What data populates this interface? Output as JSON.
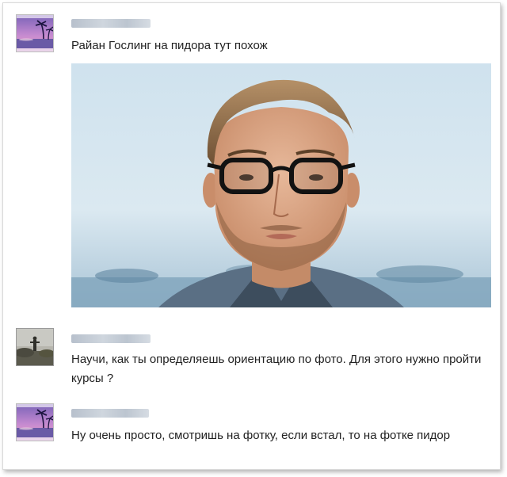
{
  "messages": [
    {
      "author_hidden": true,
      "avatar_icon": "tropical-sunset-avatar",
      "text": "Райан Гослинг на пидора тут похож",
      "has_photo": true
    },
    {
      "author_hidden": true,
      "avatar_icon": "statue-landscape-avatar",
      "text": "Научи, как ты определяешь ориентацию по фото. Для этого нужно пройти курсы ?"
    },
    {
      "author_hidden": true,
      "avatar_icon": "tropical-sunset-avatar",
      "text": "Ну очень просто, смотришь на фотку, если встал, то на фотке пидор"
    }
  ],
  "photo": {
    "subject_icon": "man-with-glasses-photo"
  }
}
